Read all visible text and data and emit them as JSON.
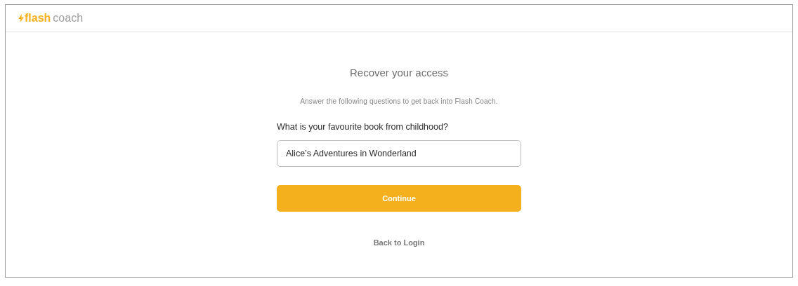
{
  "header": {
    "logo": {
      "part_1": "flash",
      "part_2": "coach"
    }
  },
  "form": {
    "title": "Recover your access",
    "subtitle": "Answer the following questions to get back into Flash Coach.",
    "question": {
      "label": "What is your favourite book from childhood?",
      "value": "Alice’s Adventures in Wonderland"
    },
    "submit": "Continue",
    "back_link": "Back to Login"
  }
}
